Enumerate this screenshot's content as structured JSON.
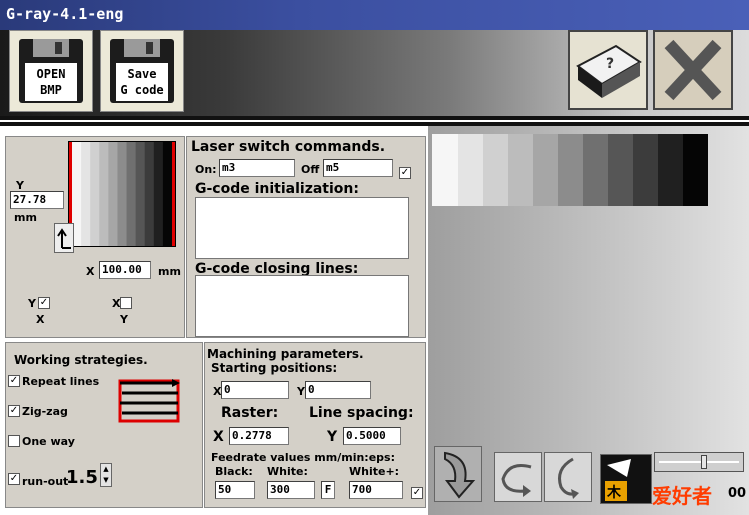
{
  "window": {
    "title": "G-ray-4.1-eng"
  },
  "toolbar": {
    "open_label_1": "OPEN",
    "open_label_2": "BMP",
    "save_label_1": "Save",
    "save_label_2": "G code"
  },
  "image_panel": {
    "y_label": "Y",
    "y_value": "27.78",
    "y_unit": "mm",
    "x_label": "X",
    "x_value": "100.00",
    "x_unit": "mm",
    "y_check_label": "Y",
    "x_check_label": "X",
    "y_under": "X",
    "x_under": "Y",
    "y_checked": "✓",
    "x_checked": ""
  },
  "laser": {
    "title": "Laser switch commands.",
    "on_label": "On:",
    "on_value": "m3",
    "off_label": "Off",
    "off_value": "m5",
    "off_checked": "✓",
    "init_label": "G-code initialization:",
    "closing_label": "G-code closing lines:"
  },
  "strategies": {
    "title": "Working strategies.",
    "repeat_lines": "Repeat lines",
    "repeat_checked": "✓",
    "zigzag": "Zig-zag",
    "zigzag_checked": "✓",
    "one_way": "One way",
    "oneway_checked": "",
    "runout": "run-out",
    "runout_checked": "✓",
    "runout_value": "1.5"
  },
  "machining": {
    "title": "Machining parameters.",
    "start_label": "Starting positions:",
    "x_label": "X",
    "x_start": "0",
    "y_label": "Y",
    "y_start": "0",
    "raster_label": "Raster:",
    "spacing_label": "Line spacing:",
    "raster_x_label": "X",
    "raster_x": "0.2778",
    "raster_y_label": "Y",
    "raster_y": "0.5000",
    "feed_label": "Feedrate values mm/min:eps:",
    "black_label": "Black:",
    "black_value": "50",
    "white_label": "White:",
    "white_value": "300",
    "f_label": "F",
    "whiteplus_label": "White+:",
    "whiteplus_value": "700",
    "whiteplus_checked": "✓"
  },
  "gray_swatches": [
    "#f6f6f6",
    "#e4e4e4",
    "#d0d0d0",
    "#bcbcbc",
    "#a6a6a6",
    "#8c8c8c",
    "#707070",
    "#565656",
    "#3c3c3c",
    "#202020",
    "#050505"
  ],
  "bottom": {
    "watermark": "爱好者",
    "counter": "00"
  }
}
